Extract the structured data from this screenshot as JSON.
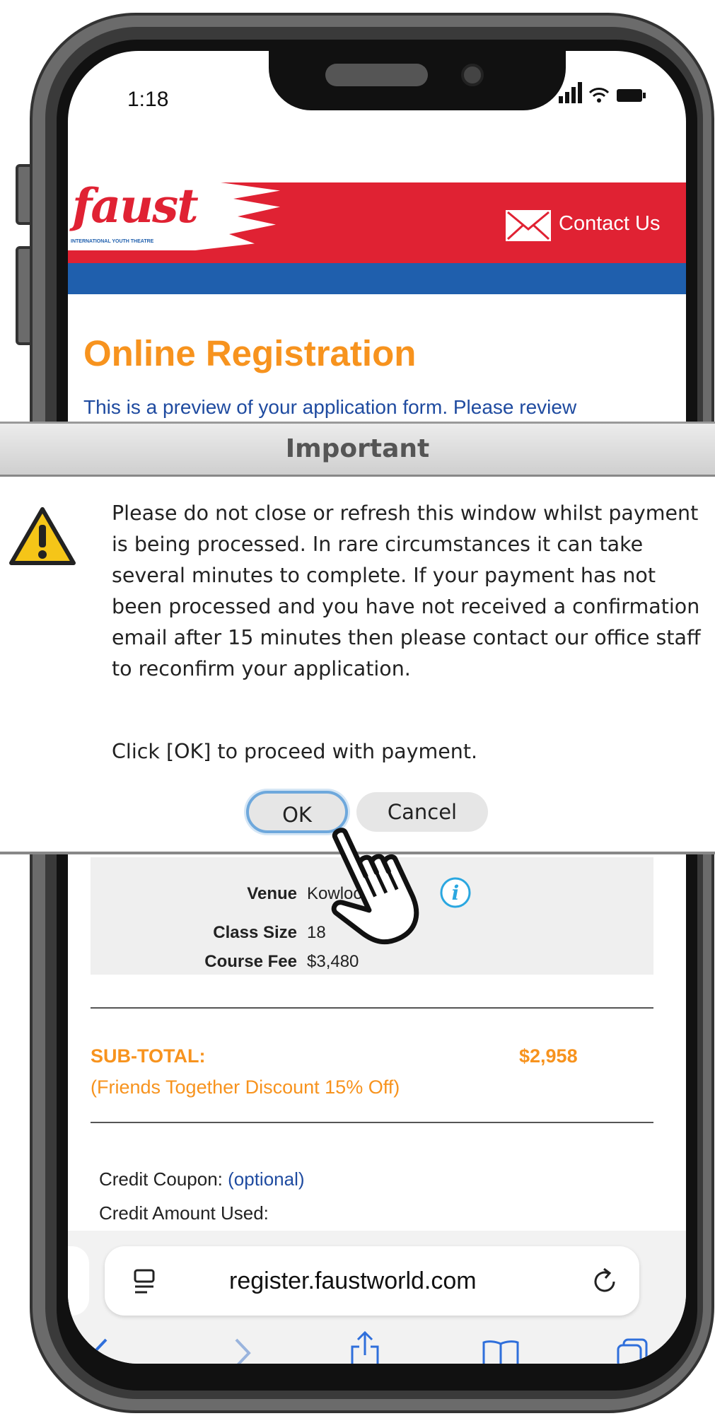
{
  "status": {
    "time": "1:18"
  },
  "header": {
    "logo": "faust",
    "logo_sub": "INTERNATIONAL YOUTH THEATRE",
    "contact_label": "Contact Us",
    "colors": {
      "red": "#e02233",
      "blue": "#1f5fad",
      "orange": "#f7931e"
    }
  },
  "page": {
    "title": "Online Registration",
    "intro": "This is a preview of your application form. Please review"
  },
  "dialog": {
    "title": "Important",
    "message": "Please do not close or refresh this window whilst payment is being processed. In rare circumstances it can take several minutes to complete. If your payment has not been processed and you have not received a confirmation email after 15 minutes then please contact our office staff to reconfirm your application.",
    "prompt": "Click [OK] to proceed with payment.",
    "ok_label": "OK",
    "cancel_label": "Cancel"
  },
  "course": {
    "venue_label": "Venue",
    "venue_value": "Kowloon Tong",
    "class_size_label": "Class Size",
    "class_size_value": "18",
    "fee_label": "Course Fee",
    "fee_value": "$3,480"
  },
  "totals": {
    "subtotal_label": "SUB-TOTAL:",
    "subtotal_value": "$2,958",
    "discount_note": "(Friends Together Discount 15% Off)"
  },
  "credit": {
    "coupon_label": "Credit Coupon:",
    "coupon_link": "(optional)",
    "amount_label": "Credit Amount Used:"
  },
  "browser": {
    "url": "register.faustworld.com"
  }
}
